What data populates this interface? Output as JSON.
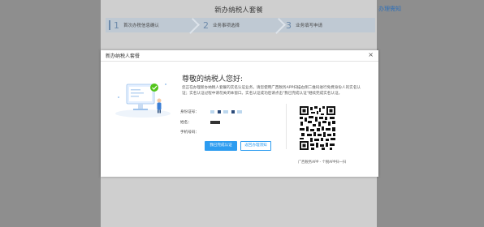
{
  "background": {
    "title": "新办纳税人套餐",
    "guide_link": "办理需知",
    "steps": [
      {
        "num": "1",
        "label": "首次办税信息确认"
      },
      {
        "num": "2",
        "label": "业务事项选择"
      },
      {
        "num": "3",
        "label": "业务填写申请"
      }
    ]
  },
  "modal": {
    "title": "新办纳税人套餐",
    "close": "×",
    "greeting": "尊敬的纳税人您好:",
    "description": "您正在办理新办纳税人套餐的实名认证业务，请您使用广西税务APP扫描右侧二维码进行免费身份人的实名认证；实名认证过程中请勿关闭本窗口。实名认证成功后请点击\"我已完成认证\"继续完成实名认证。",
    "fields": {
      "id_label": "身份证号：",
      "name_label": "姓名：",
      "phone_label": "手机号码："
    },
    "confirm_button": "我已完成认证",
    "cancel_button": "返回办理须知",
    "qr_caption": "广西税务APP - 个税APP扫一扫"
  },
  "colors": {
    "accent": "#2d9cf0",
    "overlay": "#8e8e8e",
    "check": "#52c41a"
  }
}
